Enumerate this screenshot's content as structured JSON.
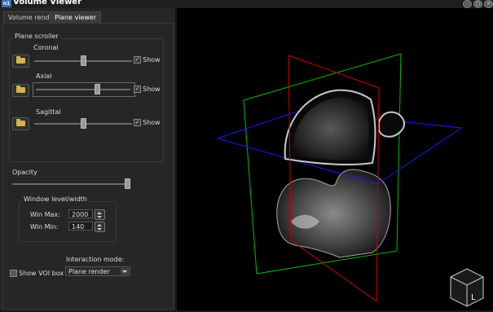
{
  "window": {
    "title": "Volume Viewer",
    "app_icon_text": "n1",
    "buttons": [
      "–",
      "□",
      "×"
    ]
  },
  "tabs": [
    {
      "label": "Volume render",
      "active": false
    },
    {
      "label": "Plane viewer",
      "active": true
    }
  ],
  "plane_scroller": {
    "title": "Plane scroller",
    "planes": [
      {
        "label": "Coronal",
        "value_fraction": 0.5,
        "show_label": "Show",
        "show_checked": true
      },
      {
        "label": "Axial",
        "value_fraction": 0.6,
        "show_label": "Show",
        "show_checked": true
      },
      {
        "label": "Sagittal",
        "value_fraction": 0.5,
        "show_label": "Show",
        "show_checked": true
      }
    ]
  },
  "opacity": {
    "label": "Opacity",
    "value_fraction": 1.0
  },
  "window_level": {
    "title": "Window level/width",
    "max_label": "Win Max:",
    "max_value": "2000",
    "min_label": "Win Min:",
    "min_value": "140"
  },
  "voi": {
    "label": "Show VOI box",
    "checked": false
  },
  "interaction": {
    "label": "Interaction mode:",
    "selected": "Plane render"
  },
  "viewport": {
    "orientation_label": "L",
    "plane_colors": {
      "coronal": "#d00000",
      "axial": "#1a1aff",
      "sagittal": "#00c000"
    }
  }
}
